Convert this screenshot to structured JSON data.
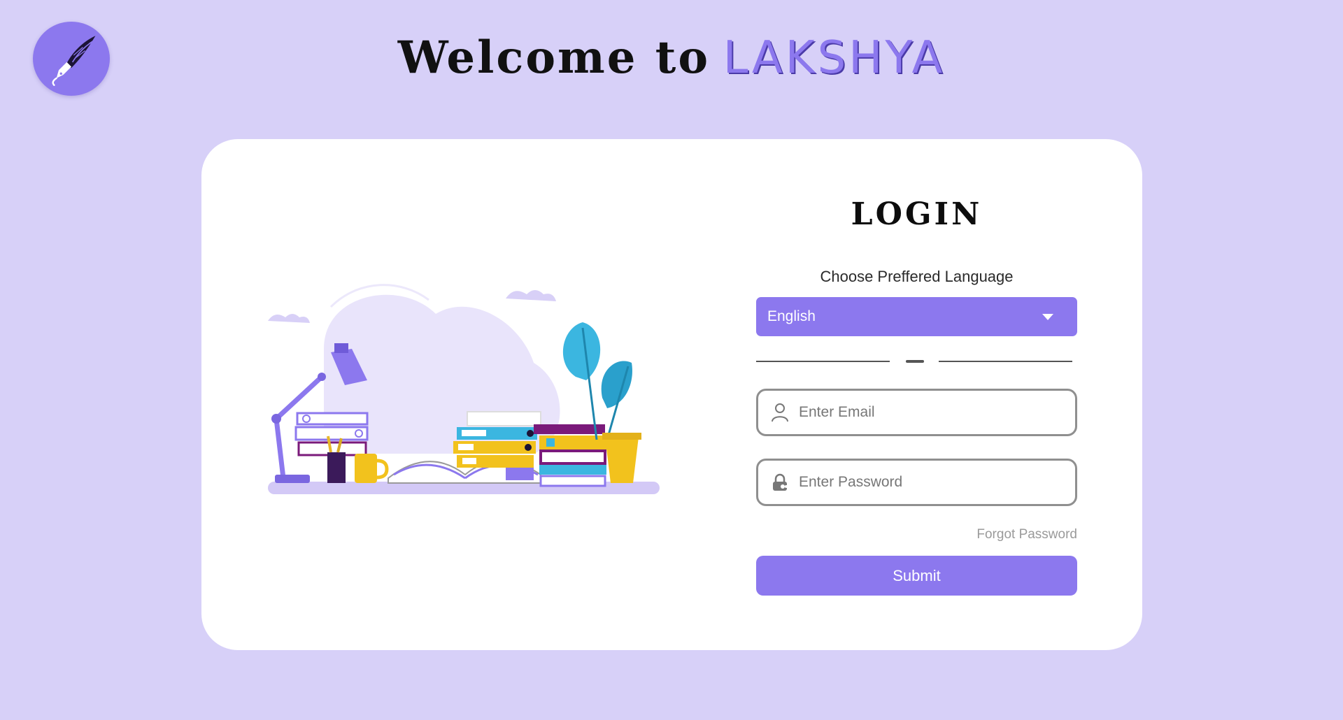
{
  "header": {
    "welcome_text": "Welcome to",
    "brand_name": "LAKSHYA",
    "logo_icon": "fountain-pen-feather-icon"
  },
  "login": {
    "title": "LOGIN",
    "language_label": "Choose Preffered Language",
    "language_selected": "English",
    "email_placeholder": "Enter Email",
    "password_placeholder": "Enter Password",
    "forgot_password": "Forgot Password",
    "submit_label": "Submit"
  },
  "colors": {
    "background": "#d7d0f8",
    "accent": "#8c78ee",
    "card": "#ffffff"
  }
}
